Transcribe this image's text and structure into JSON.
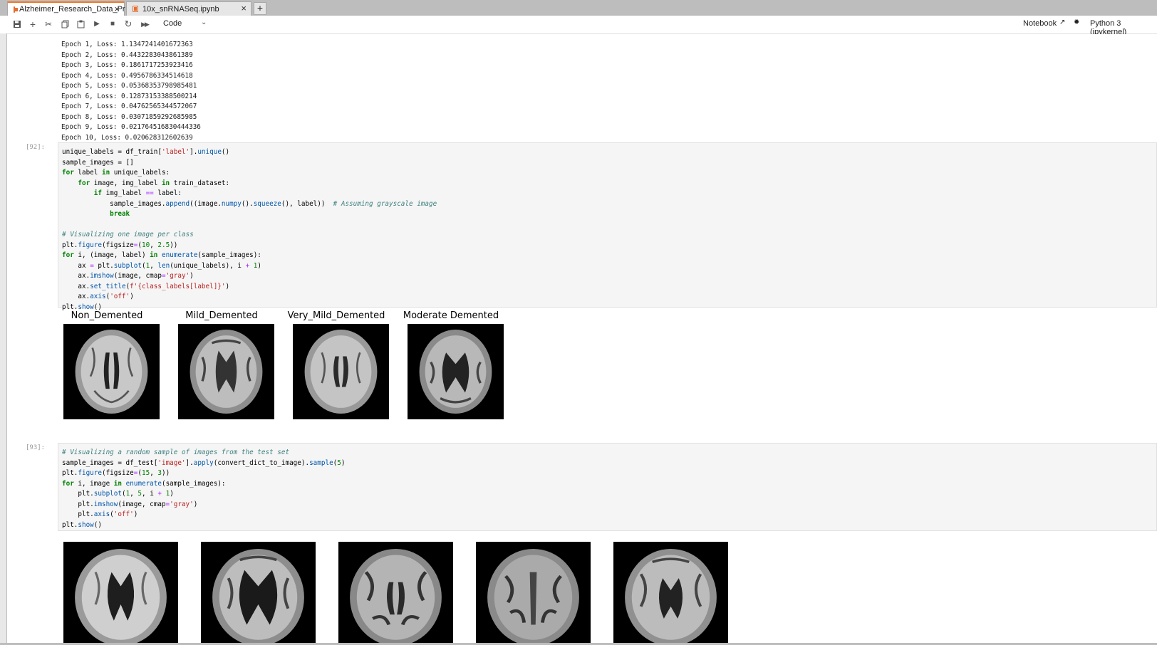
{
  "tabs": [
    {
      "label": "Alzheimer_Research_Data_Pr",
      "active": true
    },
    {
      "label": "10x_snRNASeq.ipynb",
      "active": false
    }
  ],
  "toolbar": {
    "cell_type": "Code",
    "notebook_label": "Notebook",
    "kernel": "Python 3 (ipykernel)",
    "icons": [
      "save-icon",
      "add-icon",
      "cut-icon",
      "copy-icon",
      "paste-icon",
      "run-icon",
      "stop-icon",
      "restart-icon",
      "run-all-icon"
    ]
  },
  "cells": {
    "training_output": "Epoch 1, Loss: 1.1347241401672363\nEpoch 2, Loss: 0.4432283043861389\nEpoch 3, Loss: 0.1861717253923416\nEpoch 4, Loss: 0.4956786334514618\nEpoch 5, Loss: 0.05368353798985481\nEpoch 6, Loss: 0.12873153388500214\nEpoch 7, Loss: 0.04762565344572067\nEpoch 8, Loss: 0.03071859292685985\nEpoch 9, Loss: 0.021764516830444336\nEpoch 10, Loss: 0.020628312602639",
    "cell_92": {
      "prompt": "[92]:",
      "captions": [
        "Non_Demented",
        "Mild_Demented",
        "Very_Mild_Demented",
        "Moderate Demented"
      ]
    },
    "cell_93": {
      "prompt": "[93]:"
    }
  }
}
